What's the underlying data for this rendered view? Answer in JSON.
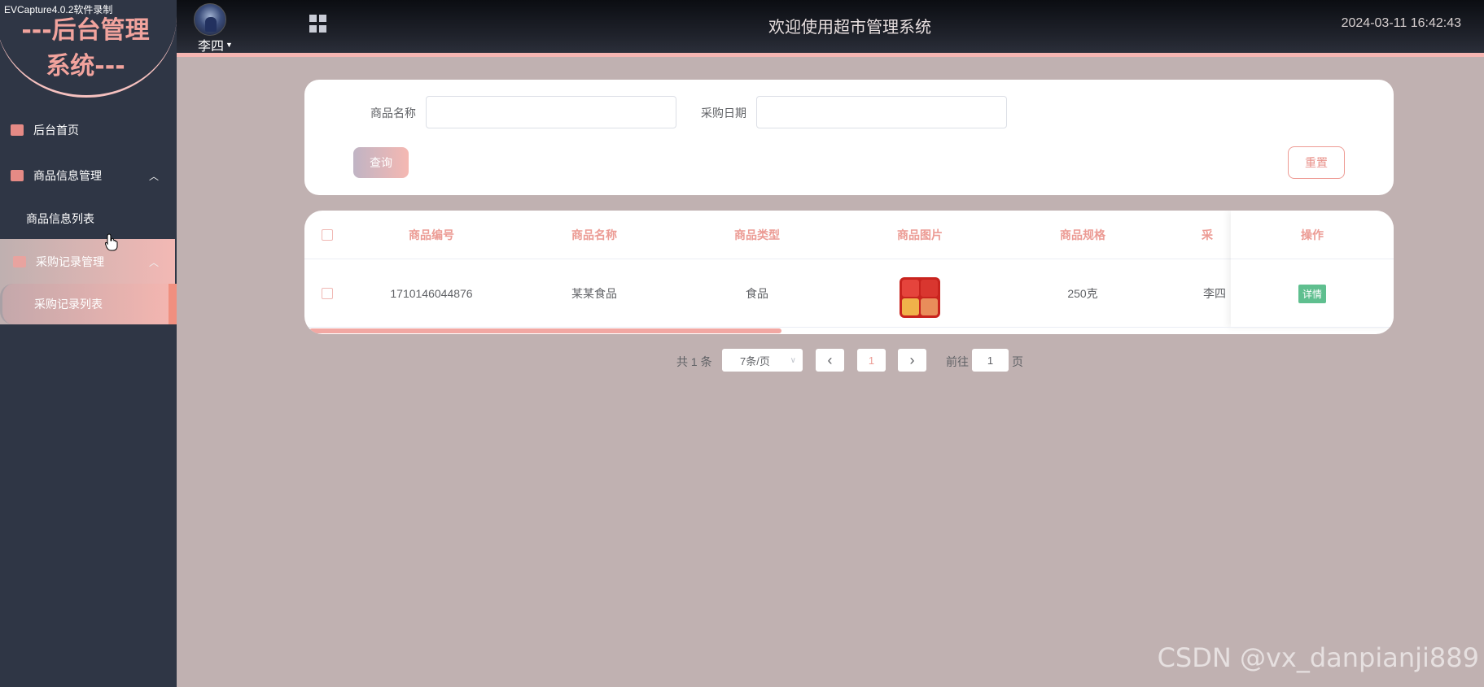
{
  "capture_watermark": "EVCapture4.0.2软件录制",
  "corner_watermark": "CSDN @vx_danpianji889",
  "header": {
    "username": "李四",
    "welcome": "欢迎使用超市管理系统",
    "datetime": "2024-03-11 16:42:43"
  },
  "sidebar": {
    "brand_line1": "---后台管理",
    "brand_line2": "系统---",
    "home": "后台首页",
    "goods_group": "商品信息管理",
    "goods_list": "商品信息列表",
    "purchase_group": "采购记录管理",
    "purchase_list": "采购记录列表"
  },
  "search": {
    "goods_name_label": "商品名称",
    "goods_name_value": "",
    "purchase_date_label": "采购日期",
    "purchase_date_value": "",
    "query_button": "查询",
    "reset_button": "重置"
  },
  "table": {
    "columns": [
      "商品编号",
      "商品名称",
      "商品类型",
      "商品图片",
      "商品规格",
      "采",
      "操作"
    ],
    "rows": [
      {
        "id": "1710146044876",
        "name": "某某食品",
        "type": "食品",
        "spec": "250克",
        "buyer": "李四",
        "action": "详情"
      }
    ]
  },
  "pagination": {
    "total": "共 1 条",
    "page_size": "7条/页",
    "prev": "‹",
    "current": "1",
    "next": "›",
    "goto_label": "前往",
    "goto_value": "1",
    "page_suffix": "页"
  },
  "colors": {
    "accent": "#f6b6b2",
    "sidebar_bg": "#2f3645",
    "content_bg": "#c0b1b1",
    "header_text": "#ec9b94",
    "detail_green": "#5fbf8f"
  }
}
